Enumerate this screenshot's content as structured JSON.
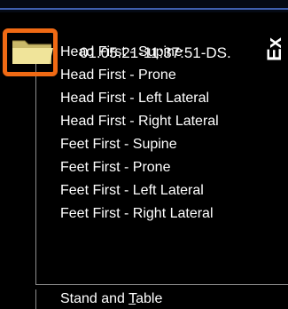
{
  "tree_node": {
    "label": "01.05.21-11:37:51-DS.",
    "side_label": "Ex"
  },
  "menu": {
    "items": [
      {
        "label": "Head First - Supine"
      },
      {
        "label": "Head First - Prone"
      },
      {
        "label": "Head First - Left Lateral"
      },
      {
        "label": "Head First - Right Lateral"
      },
      {
        "label": "Feet First - Supine"
      },
      {
        "label": "Feet First - Prone"
      },
      {
        "label": "Feet First - Left Lateral"
      },
      {
        "label": "Feet First - Right Lateral"
      }
    ],
    "footer": {
      "prefix": "Stand and ",
      "accel": "T",
      "suffix": "able"
    }
  },
  "colors": {
    "background": "#000000",
    "highlight": "#f06a14",
    "folder": "#e8dc8c",
    "text": "#ffffff"
  },
  "icons": {
    "folder": "folder-icon"
  }
}
